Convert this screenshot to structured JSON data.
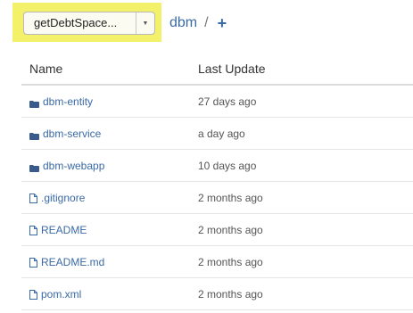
{
  "branch": {
    "label": "getDebtSpace...",
    "caret": "▼"
  },
  "breadcrumb": {
    "repo": "dbm",
    "separator": "/",
    "add": "+"
  },
  "table": {
    "headers": {
      "name": "Name",
      "date": "Last Update"
    },
    "rows": [
      {
        "type": "folder",
        "name": "dbm-entity",
        "date": "27 days ago"
      },
      {
        "type": "folder",
        "name": "dbm-service",
        "date": "a day ago"
      },
      {
        "type": "folder",
        "name": "dbm-webapp",
        "date": "10 days ago"
      },
      {
        "type": "file",
        "name": ".gitignore",
        "date": "2 months ago"
      },
      {
        "type": "file",
        "name": "README",
        "date": "2 months ago"
      },
      {
        "type": "file",
        "name": "README.md",
        "date": "2 months ago"
      },
      {
        "type": "file",
        "name": "pom.xml",
        "date": "2 months ago"
      }
    ]
  },
  "colors": {
    "link": "#3a6aa5",
    "highlight": "#f3f06a",
    "folder_icon": "#3a5a8c"
  },
  "icons": {
    "folder": "folder-icon",
    "file": "file-icon"
  }
}
